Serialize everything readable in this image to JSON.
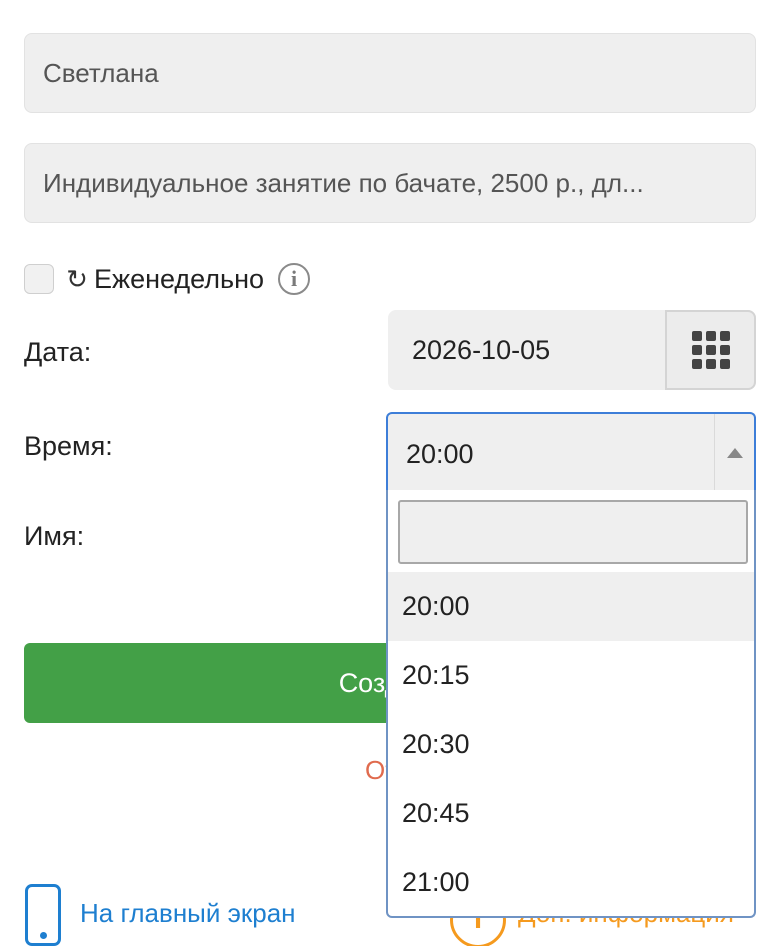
{
  "form": {
    "name_value": "Светлана",
    "service_value": "Индивидуальное занятие по бачате, 2500 р., дл...",
    "weekly": {
      "checked": false,
      "label": "Еженедельно",
      "repeat_glyph": "↻",
      "info_glyph": "i"
    },
    "date": {
      "label": "Дата:",
      "value": "2026-10-05"
    },
    "time": {
      "label": "Время:",
      "selected": "20:00",
      "search_value": "",
      "options": [
        "20:00",
        "20:15",
        "20:30",
        "20:45",
        "21:00"
      ],
      "active_index": 0
    },
    "name_label": "Имя:",
    "submit_label": "Создать",
    "cancel_label": "Отм"
  },
  "footer": {
    "home_link": "На главный экран",
    "extra_link": "Доп. информация",
    "extra_icon_glyph": "i"
  },
  "colors": {
    "primary_green": "#43a047",
    "link_blue": "#1e7fd0",
    "cancel_red": "#e06b4e",
    "accent_orange": "#f59a1e",
    "focus_border": "#3d7ed8"
  },
  "icons": {
    "repeat": "repeat-icon",
    "info": "info-icon",
    "calendar": "calendar-grid-icon",
    "dropdown_arrow": "triangle-up-icon",
    "phone": "phone-icon",
    "info_circle": "info-circle-icon"
  }
}
